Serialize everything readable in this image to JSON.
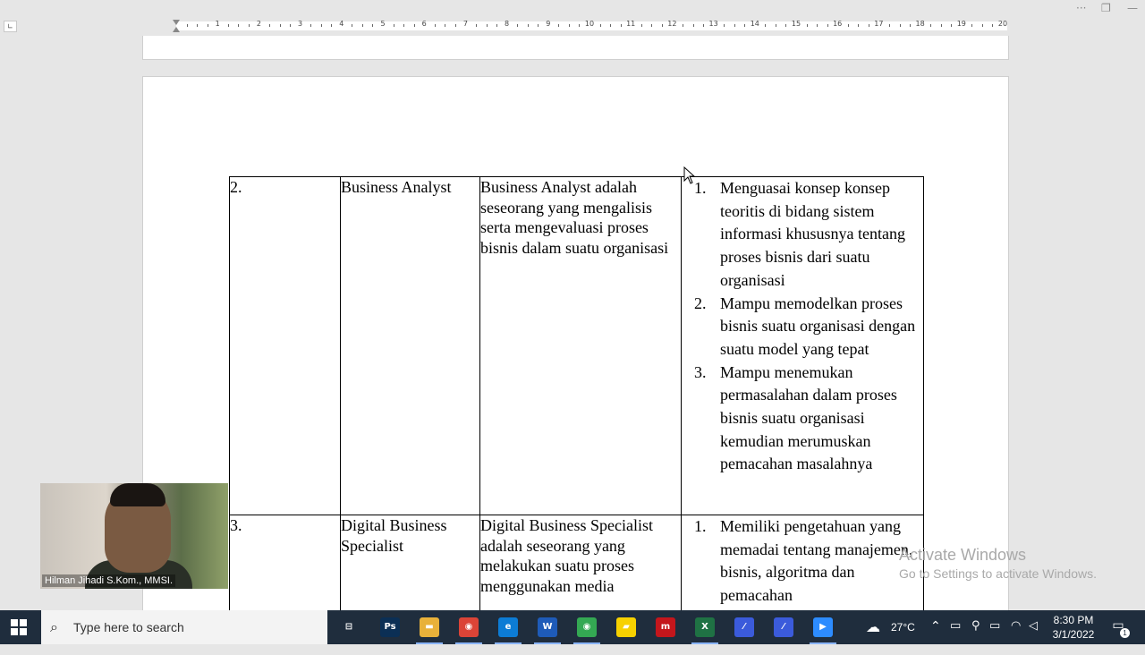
{
  "ruler": {
    "numbers": [
      "1",
      "2",
      "3",
      "4",
      "5",
      "6",
      "7",
      "8",
      "9",
      "10",
      "11",
      "12",
      "13",
      "14",
      "15",
      "16",
      "17",
      "18",
      "19",
      "20"
    ]
  },
  "window_controls": {
    "more": "···",
    "restore": "❐",
    "minimize": "—"
  },
  "table": {
    "rows": [
      {
        "number": "2.",
        "job": "Business Analyst",
        "description": "Business Analyst adalah seseorang yang mengalisis serta mengevaluasi proses bisnis dalam suatu organisasi",
        "competencies": [
          {
            "n": "1.",
            "text": "Menguasai konsep konsep teoritis di bidang sistem informasi khususnya tentang proses bisnis dari suatu organisasi"
          },
          {
            "n": "2.",
            "text": "Mampu memodelkan proses bisnis suatu organisasi dengan suatu model yang tepat"
          },
          {
            "n": "3.",
            "text": "Mampu menemukan permasalahan dalam proses bisnis suatu organisasi kemudian merumuskan pemacahan masalahnya"
          }
        ]
      },
      {
        "number": "3.",
        "job": "Digital Business Specialist",
        "description": "Digital Business Specialist adalah seseorang yang melakukan suatu proses menggunakan media",
        "competencies": [
          {
            "n": "1.",
            "text": "Memiliki pengetahuan yang memadai tentang manajemen, bisnis, algoritma dan pemacahan"
          }
        ]
      }
    ]
  },
  "webcam": {
    "participant_name": "Hilman Jihadi S.Kom., MMSI."
  },
  "watermark": {
    "title": "Activate Windows",
    "subtitle": "Go to Settings to activate Windows."
  },
  "taskbar": {
    "search_placeholder": "Type here to search",
    "apps": [
      {
        "name": "task-view",
        "label": "⊟",
        "color": "transparent"
      },
      {
        "name": "photoshop",
        "label": "Ps",
        "color": "#0b2f55"
      },
      {
        "name": "file-explorer",
        "label": "▬",
        "color": "#e8b13a"
      },
      {
        "name": "chrome",
        "label": "◉",
        "color": "#db4437"
      },
      {
        "name": "edge",
        "label": "e",
        "color": "#0c7cd5"
      },
      {
        "name": "word",
        "label": "W",
        "color": "#1e5bb8"
      },
      {
        "name": "chrome-profile",
        "label": "◉",
        "color": "#34a853"
      },
      {
        "name": "sticky-notes",
        "label": "▰",
        "color": "#f7d100"
      },
      {
        "name": "mendeley",
        "label": "m",
        "color": "#c4161c"
      },
      {
        "name": "excel",
        "label": "X",
        "color": "#1f7244"
      },
      {
        "name": "app-slash-1",
        "label": "⁄",
        "color": "#3b5bdb"
      },
      {
        "name": "app-slash-2",
        "label": "⁄",
        "color": "#3b5bdb"
      },
      {
        "name": "zoom",
        "label": "▶",
        "color": "#2d8cff"
      }
    ],
    "weather": "27°C",
    "time": "8:30 PM",
    "date": "3/1/2022",
    "notification_count": "1"
  }
}
